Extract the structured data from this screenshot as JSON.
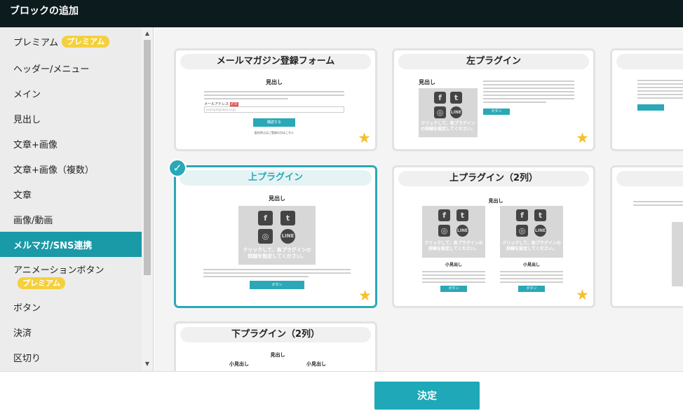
{
  "header": {
    "title": "ブロックの追加"
  },
  "sidebar": {
    "items": [
      {
        "label": "プレミアム",
        "badge": "プレミアム"
      },
      {
        "label": "ヘッダー/メニュー"
      },
      {
        "label": "メイン"
      },
      {
        "label": "見出し"
      },
      {
        "label": "文章+画像"
      },
      {
        "label": "文章+画像（複数）"
      },
      {
        "label": "文章"
      },
      {
        "label": "画像/動画"
      },
      {
        "label": "メルマガ/SNS連携",
        "active": true
      },
      {
        "label": "アニメーションボタン",
        "badge": "プレミアム"
      },
      {
        "label": "ボタン"
      },
      {
        "label": "決済"
      },
      {
        "label": "区切り"
      }
    ]
  },
  "cards": [
    {
      "title": "メールマガジン登録フォーム",
      "heading": "見出し",
      "field_label": "メールアドレス",
      "required": "必須",
      "placeholder": "example@aaaa.co.jp",
      "button": "購読する",
      "note": "配信停止はご登録の方はこちら"
    },
    {
      "title": "左プラグイン",
      "heading": "見出し",
      "sns_caption": "クリックして、各プラグインの詳細を設定してください。",
      "button": "ボタン"
    },
    {
      "title": "上プラグイン",
      "heading": "見出し",
      "sns_caption": "クリックして、各プラグインの詳細を設定してください。",
      "button": "ボタン"
    },
    {
      "title": "上プラグイン（2列）",
      "heading": "見出し",
      "subheading": "小見出し",
      "sns_caption": "クリックして、各プラグインの詳細を設定してください。",
      "button": "ボタン"
    },
    {
      "title": "下プラグイン（2列）",
      "heading": "見出し",
      "subheading": "小見出し"
    }
  ],
  "footer": {
    "submit_label": "決定"
  },
  "colors": {
    "accent": "#1ea8b8",
    "badge": "#f5d03e",
    "star": "#f5c02c",
    "header_bg": "#0c1b1e"
  },
  "icons": {
    "star": "star-icon",
    "check": "check-icon",
    "facebook": "facebook-icon",
    "twitter": "twitter-icon",
    "instagram": "instagram-icon",
    "line": "line-icon"
  }
}
